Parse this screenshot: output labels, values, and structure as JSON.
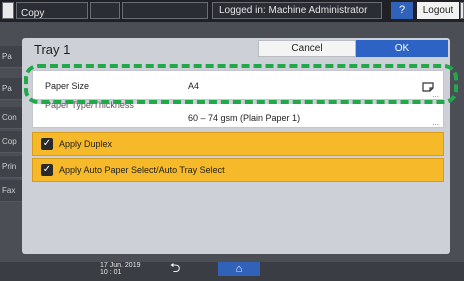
{
  "topbar": {
    "app_title": "Copy",
    "status": "Logged in: Machine Administrator",
    "help": "?",
    "logout": "Logout"
  },
  "background_tabs": [
    "Pa",
    "Pa",
    "Con",
    "Cop",
    "Prin",
    "Fax"
  ],
  "dialog": {
    "title": "Tray 1",
    "cancel": "Cancel",
    "ok": "OK",
    "rows": [
      {
        "label": "Paper Size",
        "value": "A4"
      },
      {
        "label": "Paper Type/Thickness",
        "value": "60 – 74 gsm (Plain Paper 1)"
      }
    ],
    "options": [
      {
        "label": "Apply Duplex",
        "checked": true
      },
      {
        "label": "Apply Auto Paper Select/Auto Tray Select",
        "checked": true
      }
    ]
  },
  "bottombar": {
    "date": "17 Jun. 2019",
    "time": "10 : 01"
  },
  "icons": {
    "paper_icon": "paper-size-icon",
    "back": "back-arrow-icon",
    "home": "home-icon"
  },
  "colors": {
    "accent_blue": "#2d63c4",
    "option_yellow": "#f5b92a",
    "highlight_green": "#20a84a"
  }
}
